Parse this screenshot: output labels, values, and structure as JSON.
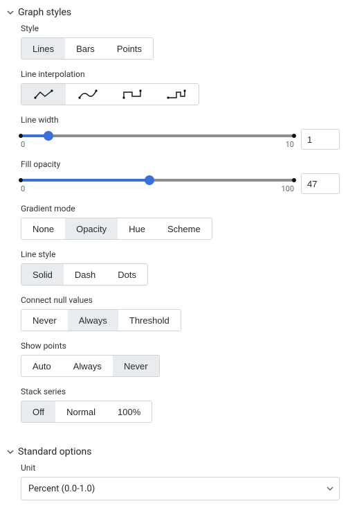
{
  "sections": {
    "graph_styles": {
      "title": "Graph styles"
    },
    "standard_options": {
      "title": "Standard options"
    }
  },
  "style": {
    "label": "Style",
    "options": [
      "Lines",
      "Bars",
      "Points"
    ],
    "selected": "Lines"
  },
  "line_interpolation": {
    "label": "Line interpolation",
    "options": [
      "linear",
      "smooth",
      "step-before",
      "step-after"
    ],
    "selected": "linear"
  },
  "line_width": {
    "label": "Line width",
    "min": "0",
    "max": "10",
    "value": "1"
  },
  "fill_opacity": {
    "label": "Fill opacity",
    "min": "0",
    "max": "100",
    "value": "47"
  },
  "gradient_mode": {
    "label": "Gradient mode",
    "options": [
      "None",
      "Opacity",
      "Hue",
      "Scheme"
    ],
    "selected": "Opacity"
  },
  "line_style": {
    "label": "Line style",
    "options": [
      "Solid",
      "Dash",
      "Dots"
    ],
    "selected": "Solid"
  },
  "connect_null": {
    "label": "Connect null values",
    "options": [
      "Never",
      "Always",
      "Threshold"
    ],
    "selected": "Always"
  },
  "show_points": {
    "label": "Show points",
    "options": [
      "Auto",
      "Always",
      "Never"
    ],
    "selected": "Never"
  },
  "stack_series": {
    "label": "Stack series",
    "options": [
      "Off",
      "Normal",
      "100%"
    ],
    "selected": "Off"
  },
  "unit": {
    "label": "Unit",
    "value": "Percent (0.0-1.0)"
  }
}
